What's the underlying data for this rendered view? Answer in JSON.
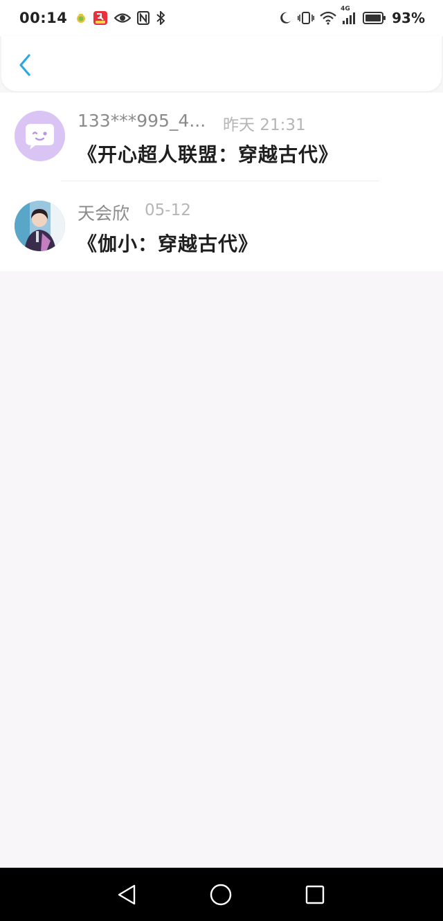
{
  "status_bar": {
    "time": "00:14",
    "battery_percent": "93%",
    "network": "4G",
    "left_icons": [
      "app-notification-icon",
      "app-red-badge-icon",
      "eye-icon",
      "nfc-icon",
      "bluetooth-icon"
    ],
    "right_icons": [
      "moon-icon",
      "vibrate-icon",
      "wifi-icon",
      "signal-icon",
      "battery-icon"
    ],
    "battery_level": 0.93
  },
  "header": {
    "back_icon": "chevron-left-icon",
    "accent_color": "#2ba8e0"
  },
  "list": {
    "items": [
      {
        "name": "133***995_4...",
        "time": "昨天 21:31",
        "title": "《开心超人联盟：穿越古代》",
        "avatar": "chat-bubble-avatar"
      },
      {
        "name": "天会欣",
        "time": "05-12",
        "title": "《伽小：穿越古代》",
        "avatar": "user-photo-avatar"
      }
    ]
  },
  "nav_bar": {
    "buttons": [
      "back-triangle-icon",
      "home-circle-icon",
      "recents-square-icon"
    ]
  }
}
